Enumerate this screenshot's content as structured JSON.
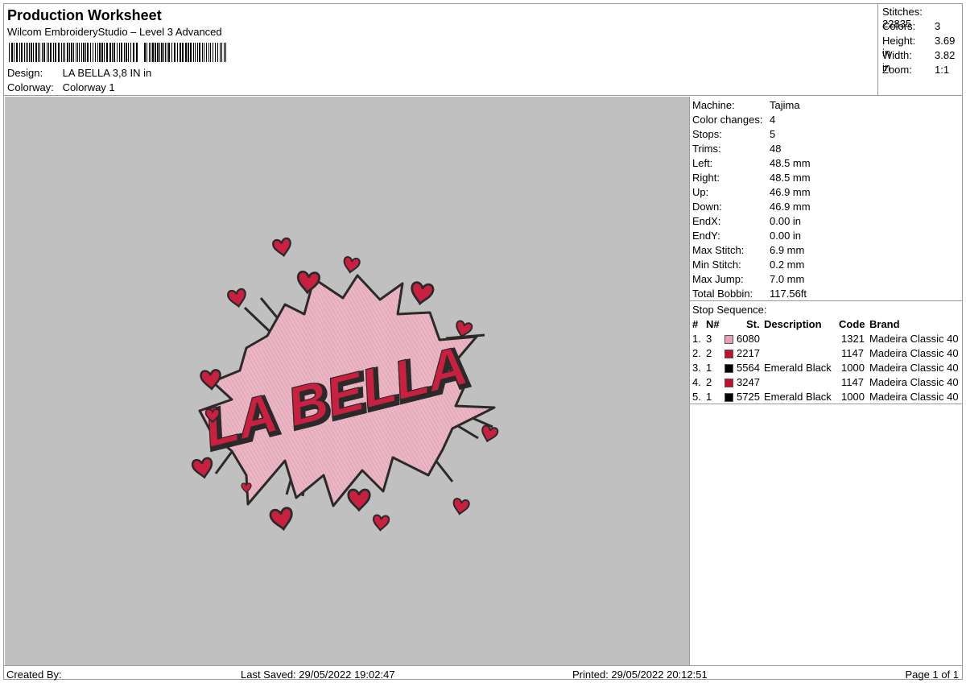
{
  "header": {
    "title": "Production Worksheet",
    "subtitle": "Wilcom EmbroideryStudio – Level 3 Advanced",
    "design_label": "Design:",
    "design_value": "LA BELLA 3,8 IN in",
    "colorway_label": "Colorway:",
    "colorway_value": "Colorway 1"
  },
  "summary": [
    {
      "label": "Stitches:",
      "value": "22835"
    },
    {
      "label": "Colors:",
      "value": "3"
    },
    {
      "label": "Height:",
      "value": "3.69 in"
    },
    {
      "label": "Width:",
      "value": "3.82 in"
    },
    {
      "label": "Zoom:",
      "value": "1:1"
    }
  ],
  "details": [
    {
      "label": "Machine:",
      "value": "Tajima"
    },
    {
      "label": "Color changes:",
      "value": "4"
    },
    {
      "label": "Stops:",
      "value": "5"
    },
    {
      "label": "Trims:",
      "value": "48"
    },
    {
      "label": "Left:",
      "value": "48.5 mm"
    },
    {
      "label": "Right:",
      "value": "48.5 mm"
    },
    {
      "label": "Up:",
      "value": "46.9 mm"
    },
    {
      "label": "Down:",
      "value": "46.9 mm"
    },
    {
      "label": "EndX:",
      "value": "0.00 in"
    },
    {
      "label": "EndY:",
      "value": "0.00 in"
    },
    {
      "label": "Max Stitch:",
      "value": "6.9 mm"
    },
    {
      "label": "Min Stitch:",
      "value": "0.2 mm"
    },
    {
      "label": "Max Jump:",
      "value": "7.0 mm"
    },
    {
      "label": "Total Bobbin:",
      "value": "117.56ft"
    }
  ],
  "stop_sequence": {
    "title": "Stop Sequence:",
    "columns": {
      "num": "#",
      "n": "N#",
      "st": "St.",
      "desc": "Description",
      "code": "Code",
      "brand": "Brand"
    },
    "rows": [
      {
        "num": "1.",
        "n": "3",
        "color": "#e8a0b4",
        "st": "6080",
        "desc": "",
        "code": "1321",
        "brand": "Madeira Classic 40"
      },
      {
        "num": "2.",
        "n": "2",
        "color": "#c0102c",
        "st": "2217",
        "desc": "",
        "code": "1147",
        "brand": "Madeira Classic 40"
      },
      {
        "num": "3.",
        "n": "1",
        "color": "#000000",
        "st": "5564",
        "desc": "Emerald Black",
        "code": "1000",
        "brand": "Madeira Classic 40"
      },
      {
        "num": "4.",
        "n": "2",
        "color": "#c0102c",
        "st": "3247",
        "desc": "",
        "code": "1147",
        "brand": "Madeira Classic 40"
      },
      {
        "num": "5.",
        "n": "1",
        "color": "#000000",
        "st": "5725",
        "desc": "Emerald Black",
        "code": "1000",
        "brand": "Madeira Classic 40"
      }
    ]
  },
  "design_art": {
    "text": "LA BELLA",
    "background_color": "#c0c0c0",
    "fill_color": "#eab6c4",
    "outline_color": "#2a2a2a",
    "heart_color": "#c8203e"
  },
  "footer": {
    "created_by": "Created By:",
    "last_saved": "Last Saved: 29/05/2022 19:02:47",
    "printed": "Printed: 29/05/2022 20:12:51",
    "page": "Page 1 of 1"
  }
}
